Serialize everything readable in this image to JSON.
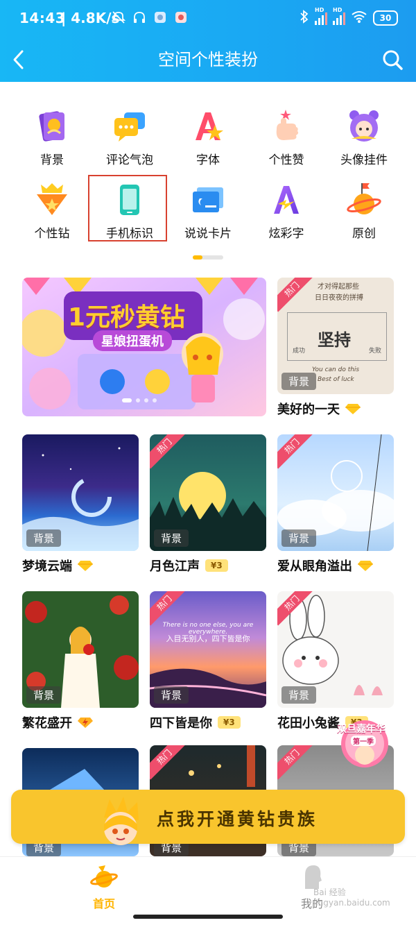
{
  "status_bar": {
    "time": "14:43",
    "speed": "| 4.8K/s",
    "battery": "30",
    "hd1": "HD",
    "hd2": "HD"
  },
  "header": {
    "title": "空间个性装扮"
  },
  "categories": [
    {
      "label": "背景",
      "icon": "background-icon"
    },
    {
      "label": "评论气泡",
      "icon": "comment-bubble-icon"
    },
    {
      "label": "字体",
      "icon": "font-icon"
    },
    {
      "label": "个性赞",
      "icon": "like-icon"
    },
    {
      "label": "头像挂件",
      "icon": "avatar-pendant-icon"
    },
    {
      "label": "个性钻",
      "icon": "diamond-badge-icon"
    },
    {
      "label": "手机标识",
      "icon": "phone-icon"
    },
    {
      "label": "说说卡片",
      "icon": "card-icon"
    },
    {
      "label": "炫彩字",
      "icon": "colorful-text-icon"
    },
    {
      "label": "原创",
      "icon": "original-planet-icon"
    }
  ],
  "banner": {
    "headline": "1元秒黄钻",
    "subline": "星娘扭蛋机"
  },
  "items": [
    {
      "name": "美好的一天",
      "tag": "背景",
      "hot": "热门",
      "badge": "gem",
      "art": {
        "quote1": "才对得起那些",
        "quote2": "日日夜夜的拼搏",
        "big": "坚持",
        "left": "成功",
        "right": "失败",
        "en1": "You can do this",
        "en2": "Best of luck"
      }
    },
    {
      "name": "梦境云端",
      "tag": "背景",
      "badge": "gem"
    },
    {
      "name": "月色江声",
      "tag": "背景",
      "hot": "热门",
      "price": "¥3"
    },
    {
      "name": "爱从眼角溢出",
      "tag": "背景",
      "hot": "热门",
      "badge": "gem"
    },
    {
      "name": "繁花盛开",
      "tag": "背景",
      "badge": "lightning"
    },
    {
      "name": "四下皆是你",
      "tag": "背景",
      "hot": "热门",
      "price": "¥3",
      "art": {
        "en": "There is no one else, you are everywhere.",
        "zh": "入目无别人，四下皆是你"
      }
    },
    {
      "name": "花田小兔酱",
      "tag": "背景",
      "hot": "热门",
      "price": "¥3"
    },
    {
      "tag": "背景"
    },
    {
      "tag": "背景",
      "hot": "热门"
    },
    {
      "tag": "背景",
      "hot": "热门"
    }
  ],
  "cta": {
    "label": "点我开通黄钻贵族"
  },
  "promo_sticker": {
    "line1": "双旦嘉年华",
    "line2": "第一季"
  },
  "nav": [
    {
      "label": "首页",
      "active": true
    },
    {
      "label": "我的"
    }
  ],
  "watermark": "Bai 经验 jingyan.baidu.com",
  "colors": {
    "accent": "#ffbb00",
    "header": "#1aa8f3",
    "hot": "#ee4e6c",
    "highlight_box": "#d8412f"
  }
}
